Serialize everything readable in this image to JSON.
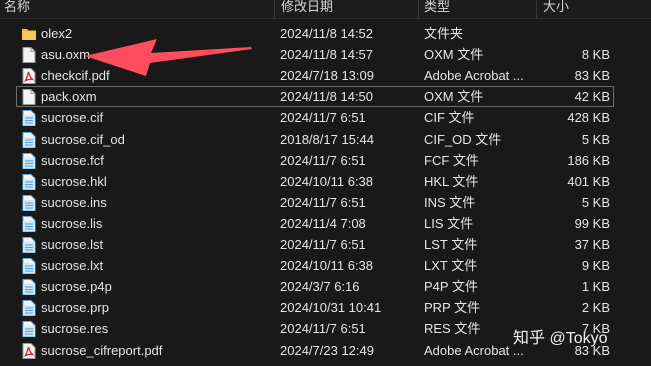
{
  "columns": {
    "name": "名称",
    "date": "修改日期",
    "type": "类型",
    "size": "大小"
  },
  "files": [
    {
      "icon": "folder-icon",
      "name": "olex2",
      "date": "2024/11/8 14:52",
      "type": "文件夹",
      "size": ""
    },
    {
      "icon": "file-icon",
      "name": "asu.oxm",
      "date": "2024/11/8 14:57",
      "type": "OXM 文件",
      "size": "8 KB"
    },
    {
      "icon": "pdf-icon",
      "name": "checkcif.pdf",
      "date": "2024/7/18 13:09",
      "type": "Adobe Acrobat ...",
      "size": "83 KB"
    },
    {
      "icon": "file-icon",
      "name": "pack.oxm",
      "date": "2024/11/8 14:50",
      "type": "OXM 文件",
      "size": "42 KB"
    },
    {
      "icon": "data-file-icon",
      "name": "sucrose.cif",
      "date": "2024/11/7 6:51",
      "type": "CIF 文件",
      "size": "428 KB"
    },
    {
      "icon": "data-file-icon",
      "name": "sucrose.cif_od",
      "date": "2018/8/17 15:44",
      "type": "CIF_OD 文件",
      "size": "5 KB"
    },
    {
      "icon": "data-file-icon",
      "name": "sucrose.fcf",
      "date": "2024/11/7 6:51",
      "type": "FCF 文件",
      "size": "186 KB"
    },
    {
      "icon": "data-file-icon",
      "name": "sucrose.hkl",
      "date": "2024/10/11 6:38",
      "type": "HKL 文件",
      "size": "401 KB"
    },
    {
      "icon": "data-file-icon",
      "name": "sucrose.ins",
      "date": "2024/11/7 6:51",
      "type": "INS 文件",
      "size": "5 KB"
    },
    {
      "icon": "data-file-icon",
      "name": "sucrose.lis",
      "date": "2024/11/4 7:08",
      "type": "LIS 文件",
      "size": "99 KB"
    },
    {
      "icon": "data-file-icon",
      "name": "sucrose.lst",
      "date": "2024/11/7 6:51",
      "type": "LST 文件",
      "size": "37 KB"
    },
    {
      "icon": "data-file-icon",
      "name": "sucrose.lxt",
      "date": "2024/10/11 6:38",
      "type": "LXT 文件",
      "size": "9 KB"
    },
    {
      "icon": "data-file-icon",
      "name": "sucrose.p4p",
      "date": "2024/3/7 6:16",
      "type": "P4P 文件",
      "size": "1 KB"
    },
    {
      "icon": "data-file-icon",
      "name": "sucrose.prp",
      "date": "2024/10/31 10:41",
      "type": "PRP 文件",
      "size": "2 KB"
    },
    {
      "icon": "data-file-icon",
      "name": "sucrose.res",
      "date": "2024/11/7 6:51",
      "type": "RES 文件",
      "size": "7 KB"
    },
    {
      "icon": "pdf-icon",
      "name": "sucrose_cifreport.pdf",
      "date": "2024/7/23 12:49",
      "type": "Adobe Acrobat ...",
      "size": "83 KB"
    }
  ],
  "selected_index": 3,
  "annotation": {
    "icon": "red-arrow-annotation",
    "color": "#ff4d5e"
  },
  "watermark": "知乎 @Tokyo"
}
